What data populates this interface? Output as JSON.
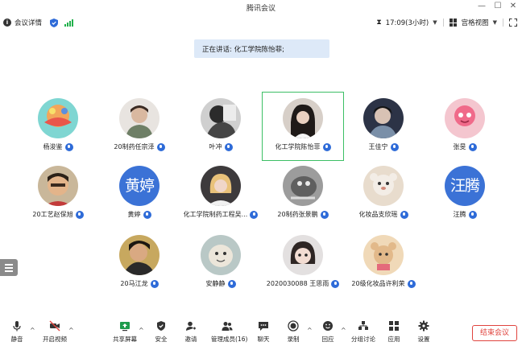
{
  "window": {
    "title": "腾讯会议",
    "controls": [
      "minimize-icon",
      "maximize-icon",
      "close-icon"
    ]
  },
  "infobar": {
    "meeting_info": "会议详情",
    "time": "17:09(3小时)",
    "view_mode": "宫格视图"
  },
  "speaking_banner": "正在讲话: 化工学院陈怡菲;",
  "participants": [
    {
      "name": "杨浚鉴",
      "avatar": "photo"
    },
    {
      "name": "20制药任宗泽",
      "avatar": "photo"
    },
    {
      "name": "叶冲",
      "avatar": "photo"
    },
    {
      "name": "化工学院陈怡菲",
      "avatar": "photo",
      "speaking": true
    },
    {
      "name": "王佳宁",
      "avatar": "photo"
    },
    {
      "name": "张旻",
      "avatar": "photo"
    },
    {
      "name": "20工艺赵保旭",
      "avatar": "photo"
    },
    {
      "name": "黄婷",
      "avatar": "text",
      "avatar_text": "黄婷"
    },
    {
      "name": "化工学院制药工程吴...",
      "avatar": "photo"
    },
    {
      "name": "20制药张景鹏",
      "avatar": "photo"
    },
    {
      "name": "化妆品支欣瑶",
      "avatar": "photo"
    },
    {
      "name": "汪腾",
      "avatar": "text",
      "avatar_text": "汪腾"
    },
    {
      "name": "20马江龙",
      "avatar": "photo"
    },
    {
      "name": "安静静",
      "avatar": "photo"
    },
    {
      "name": "2020030088 王思雨",
      "avatar": "photo"
    },
    {
      "name": "20级化妆品许利荣",
      "avatar": "photo"
    }
  ],
  "toolbar": {
    "mute": "静音",
    "start_video": "开启视频",
    "share_screen": "共享屏幕",
    "security": "安全",
    "invite": "邀请",
    "manage_members": "管理成员(16)",
    "chat": "聊天",
    "record": "录制",
    "react": "回应",
    "breakout": "分组讨论",
    "apps": "应用",
    "settings": "设置",
    "end_meeting": "结束会议"
  },
  "colors": {
    "accent": "#2e6bd8",
    "speaker_border": "#3cbf65",
    "end_button": "#e0443e",
    "banner_bg": "#dde9f8"
  }
}
